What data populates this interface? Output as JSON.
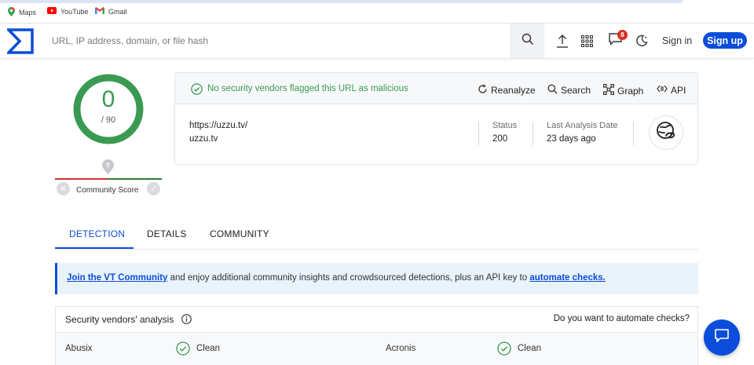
{
  "bookmarks": [
    {
      "label": "Maps",
      "icon": "maps-pin-icon"
    },
    {
      "label": "YouTube",
      "icon": "youtube-icon"
    },
    {
      "label": "Gmail",
      "icon": "gmail-icon"
    }
  ],
  "header": {
    "search_placeholder": "URL, IP address, domain, or file hash",
    "notifications_count": "8",
    "sign_in": "Sign in",
    "sign_up": "Sign up"
  },
  "score": {
    "detections": "0",
    "total": "/ 90",
    "community_label": "Community Score"
  },
  "summary": {
    "status_message": "No security vendors flagged this URL as malicious",
    "actions": {
      "reanalyze": "Reanalyze",
      "search": "Search",
      "graph": "Graph",
      "api": "API"
    },
    "url_full": "https://uzzu.tv/",
    "url_domain": "uzzu.tv",
    "status_label": "Status",
    "status_value": "200",
    "last_analysis_label": "Last Analysis Date",
    "last_analysis_value": "23 days ago"
  },
  "tabs": [
    {
      "label": "DETECTION",
      "active": true
    },
    {
      "label": "DETAILS",
      "active": false
    },
    {
      "label": "COMMUNITY",
      "active": false
    }
  ],
  "banner": {
    "link1": "Join the VT Community",
    "middle": " and enjoy additional community insights and crowdsourced detections, plus an API key to ",
    "link2": "automate checks."
  },
  "vendors": {
    "title": "Security vendors' analysis",
    "automate_prompt": "Do you want to automate checks?",
    "rows": [
      [
        {
          "name": "Abusix",
          "result": "Clean"
        },
        {
          "name": "Acronis",
          "result": "Clean"
        }
      ]
    ]
  },
  "colors": {
    "accent_blue": "#0b4dda",
    "clean_green": "#3a9a52",
    "malicious_red": "#d32f2f"
  }
}
